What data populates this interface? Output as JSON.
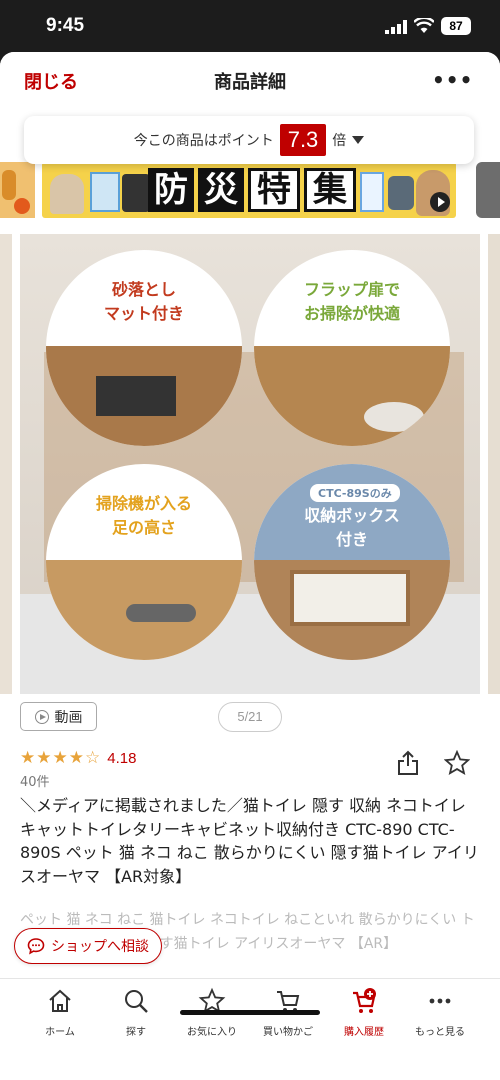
{
  "status_bar": {
    "time": "9:45",
    "battery": "87"
  },
  "header": {
    "close_label": "閉じる",
    "title": "商品詳細",
    "more_label": "•••"
  },
  "points": {
    "prefix": "今この商品はポイント",
    "rate": "7.3",
    "suffix": "倍"
  },
  "banner": {
    "chars": [
      "防",
      "災",
      "特",
      "集"
    ]
  },
  "gallery": {
    "captions": [
      {
        "line1": "砂落とし",
        "line2": "マット付き"
      },
      {
        "line1": "フラップ扉で",
        "line2": "お掃除が快適"
      },
      {
        "line1": "掃除機が入る",
        "line2": "足の高さ"
      },
      {
        "tag": "CTC-89Sのみ",
        "line1": "収納ボックス",
        "line2": "付き"
      }
    ],
    "video_label": "動画",
    "page_indicator": "5/21"
  },
  "rating": {
    "stars": 4.18,
    "value_text": "4.18",
    "review_count": "40件"
  },
  "product": {
    "title": "＼メディアに掲載されました／猫トイレ 隠す 収納 ネコトイレ キャットトイレタリーキャビネット収納付き CTC-890 CTC-890S ペット 猫 ネコ ねこ 散らかりにくい 隠す猫トイレ アイリスオーヤマ 【AR対象】",
    "description": "ペット 猫 ネコ ねこ 猫トイレ ネコトイレ ねこといれ 散らかりにくい トイレ ト Cat ＣＡＴ 隠す猫トイレ アイリスオーヤマ 【AR】"
  },
  "shop_consult_label": "ショップへ相談",
  "nav": {
    "items": [
      {
        "label": "ホーム",
        "icon": "home-icon"
      },
      {
        "label": "探す",
        "icon": "search-icon"
      },
      {
        "label": "お気に入り",
        "icon": "star-icon"
      },
      {
        "label": "買い物かご",
        "icon": "cart-icon"
      },
      {
        "label": "購入履歴",
        "icon": "purchase-history-icon",
        "active": true
      },
      {
        "label": "もっと見る",
        "icon": "more-icon"
      }
    ]
  },
  "colors": {
    "accent": "#bf0000",
    "star": "#e8a33a"
  }
}
